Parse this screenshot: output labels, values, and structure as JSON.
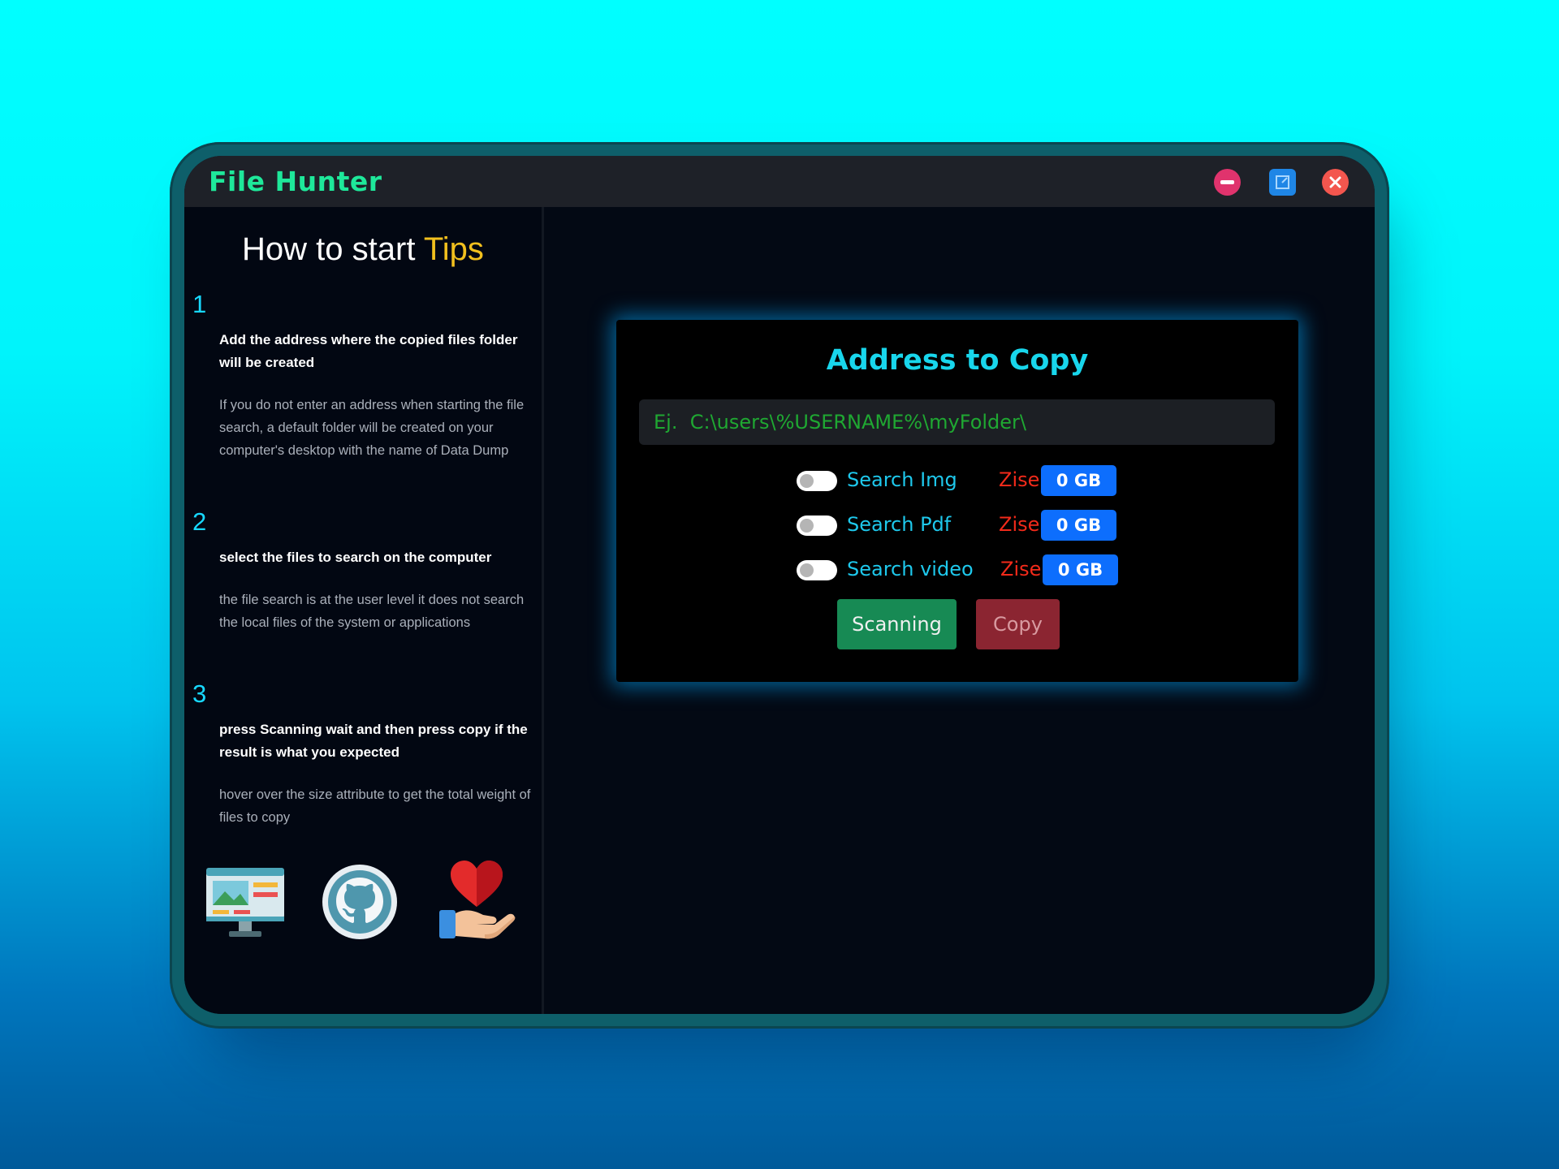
{
  "window": {
    "title": "File Hunter"
  },
  "tips": {
    "title_prefix": "How to start ",
    "title_highlight": "Tips",
    "steps": [
      {
        "number": "1",
        "heading": "Add the address where the copied files folder will be created",
        "body": "If you do not enter an address when starting the file search, a default folder will be created on your computer's desktop with the name of Data Dump"
      },
      {
        "number": "2",
        "heading": "select the files to search on the computer",
        "body": "the file search is at the user level it does not search the local files of the system or applications"
      },
      {
        "number": "3",
        "heading": "press Scanning wait and then press copy if the result is what you expected",
        "body": "hover over the size attribute to get the total weight of files to copy"
      }
    ]
  },
  "panel": {
    "title": "Address to Copy",
    "address_placeholder": "Ej.  C:\\users\\%USERNAME%\\myFolder\\",
    "address_value": "",
    "options": [
      {
        "label": "Search Img",
        "size_label": "Zise",
        "size": "0 GB",
        "enabled": false
      },
      {
        "label": "Search Pdf",
        "size_label": "Zise",
        "size": "0 GB",
        "enabled": false
      },
      {
        "label": "Search video",
        "size_label": "Zise",
        "size": "0 GB",
        "enabled": false
      }
    ],
    "scan_label": "Scanning",
    "copy_label": "Copy"
  },
  "colors": {
    "app_title": "#1ee89a",
    "accent_cyan": "#18d6ec",
    "tips_highlight": "#f2c01e",
    "size_label": "#f22a1a",
    "size_badge": "#0d6efd",
    "scan_button": "#178a54",
    "copy_button": "#8b2531"
  },
  "icons": [
    "desktop-monitor-icon",
    "github-icon",
    "heart-hand-icon"
  ]
}
